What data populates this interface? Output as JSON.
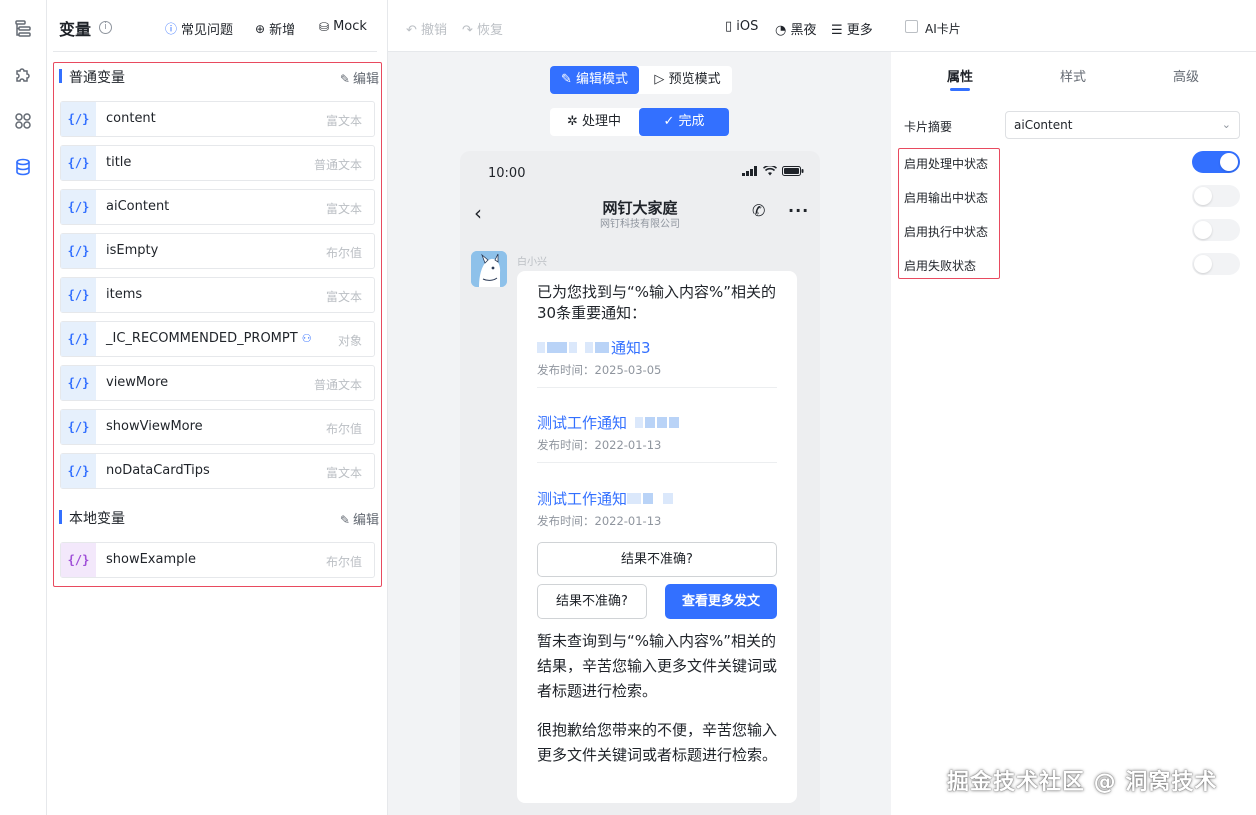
{
  "rail": {
    "icons": [
      "outline-icon",
      "puzzle-icon",
      "components-icon",
      "database-icon"
    ]
  },
  "vars_panel": {
    "title": "变量",
    "info_icon": "i",
    "faq_label": "常见问题",
    "add_label": "新增",
    "mock_label": "Mock",
    "global_section": {
      "label": "普通变量",
      "edit_label": "编辑",
      "items": [
        {
          "badge": "{/}",
          "name": "content",
          "type": "富文本"
        },
        {
          "badge": "{/}",
          "name": "title",
          "type": "普通文本"
        },
        {
          "badge": "{/}",
          "name": "aiContent",
          "type": "富文本"
        },
        {
          "badge": "{/}",
          "name": "isEmpty",
          "type": "布尔值"
        },
        {
          "badge": "{/}",
          "name": "items",
          "type": "富文本"
        },
        {
          "badge": "{/}",
          "name": "_IC_RECOMMENDED_PROMPT",
          "type": "对象"
        },
        {
          "badge": "{/}",
          "name": "viewMore",
          "type": "普通文本"
        },
        {
          "badge": "{/}",
          "name": "showViewMore",
          "type": "布尔值"
        },
        {
          "badge": "{/}",
          "name": "noDataCardTips",
          "type": "富文本"
        }
      ]
    },
    "local_section": {
      "label": "本地变量",
      "edit_label": "编辑",
      "items": [
        {
          "badge": "{/}",
          "name": "showExample",
          "type": "布尔值"
        }
      ]
    }
  },
  "toolbar": {
    "undo_label": "撤销",
    "redo_label": "恢复",
    "ios_label": "iOS",
    "dark_label": "黑夜",
    "more_label": "更多"
  },
  "modes": {
    "edit_label": "编辑模式",
    "preview_label": "预览模式",
    "processing_label": "处理中",
    "done_label": "完成",
    "active_mode": "edit",
    "active_state": "done"
  },
  "phone": {
    "time": "10:00",
    "chat_title": "网钉大家庭",
    "chat_subtitle": "网钉科技有限公司",
    "sender": "白小兴",
    "intro": "已为您找到与“%输入内容%”相关的30条重要通知：",
    "notices": [
      {
        "title": "通知3",
        "date": "发布时间：2025-03-05"
      },
      {
        "title": "测试工作通知",
        "date": "发布时间：2022-01-13"
      },
      {
        "title": "测试工作通知",
        "date": "发布时间：2022-01-13"
      }
    ],
    "btn_feedback_full": "结果不准确?",
    "btn_feedback": "结果不准确?",
    "btn_more": "查看更多发文",
    "no_data_text": "暂未查询到与“%输入内容%”相关的结果，辛苦您输入更多文件关键词或者标题进行检索。",
    "apology_text": "很抱歉给您带来的不便，辛苦您输入更多文件关键词或者标题进行检索。"
  },
  "props_panel": {
    "ai_card_label": "AI卡片",
    "ai_card_checked": false,
    "tabs": [
      "属性",
      "样式",
      "高级"
    ],
    "active_tab": "属性",
    "summary_label": "卡片摘要",
    "summary_value": "aiContent",
    "switches": [
      {
        "label": "启用处理中状态",
        "on": true
      },
      {
        "label": "启用输出中状态",
        "on": false
      },
      {
        "label": "启用执行中状态",
        "on": false
      },
      {
        "label": "启用失败状态",
        "on": false
      }
    ]
  },
  "watermark": "掘金技术社区 @ 洞窝技术",
  "colors": {
    "accent": "#3370ff",
    "highlight_border": "#e84a5f",
    "local_badge": "#a050d8"
  }
}
